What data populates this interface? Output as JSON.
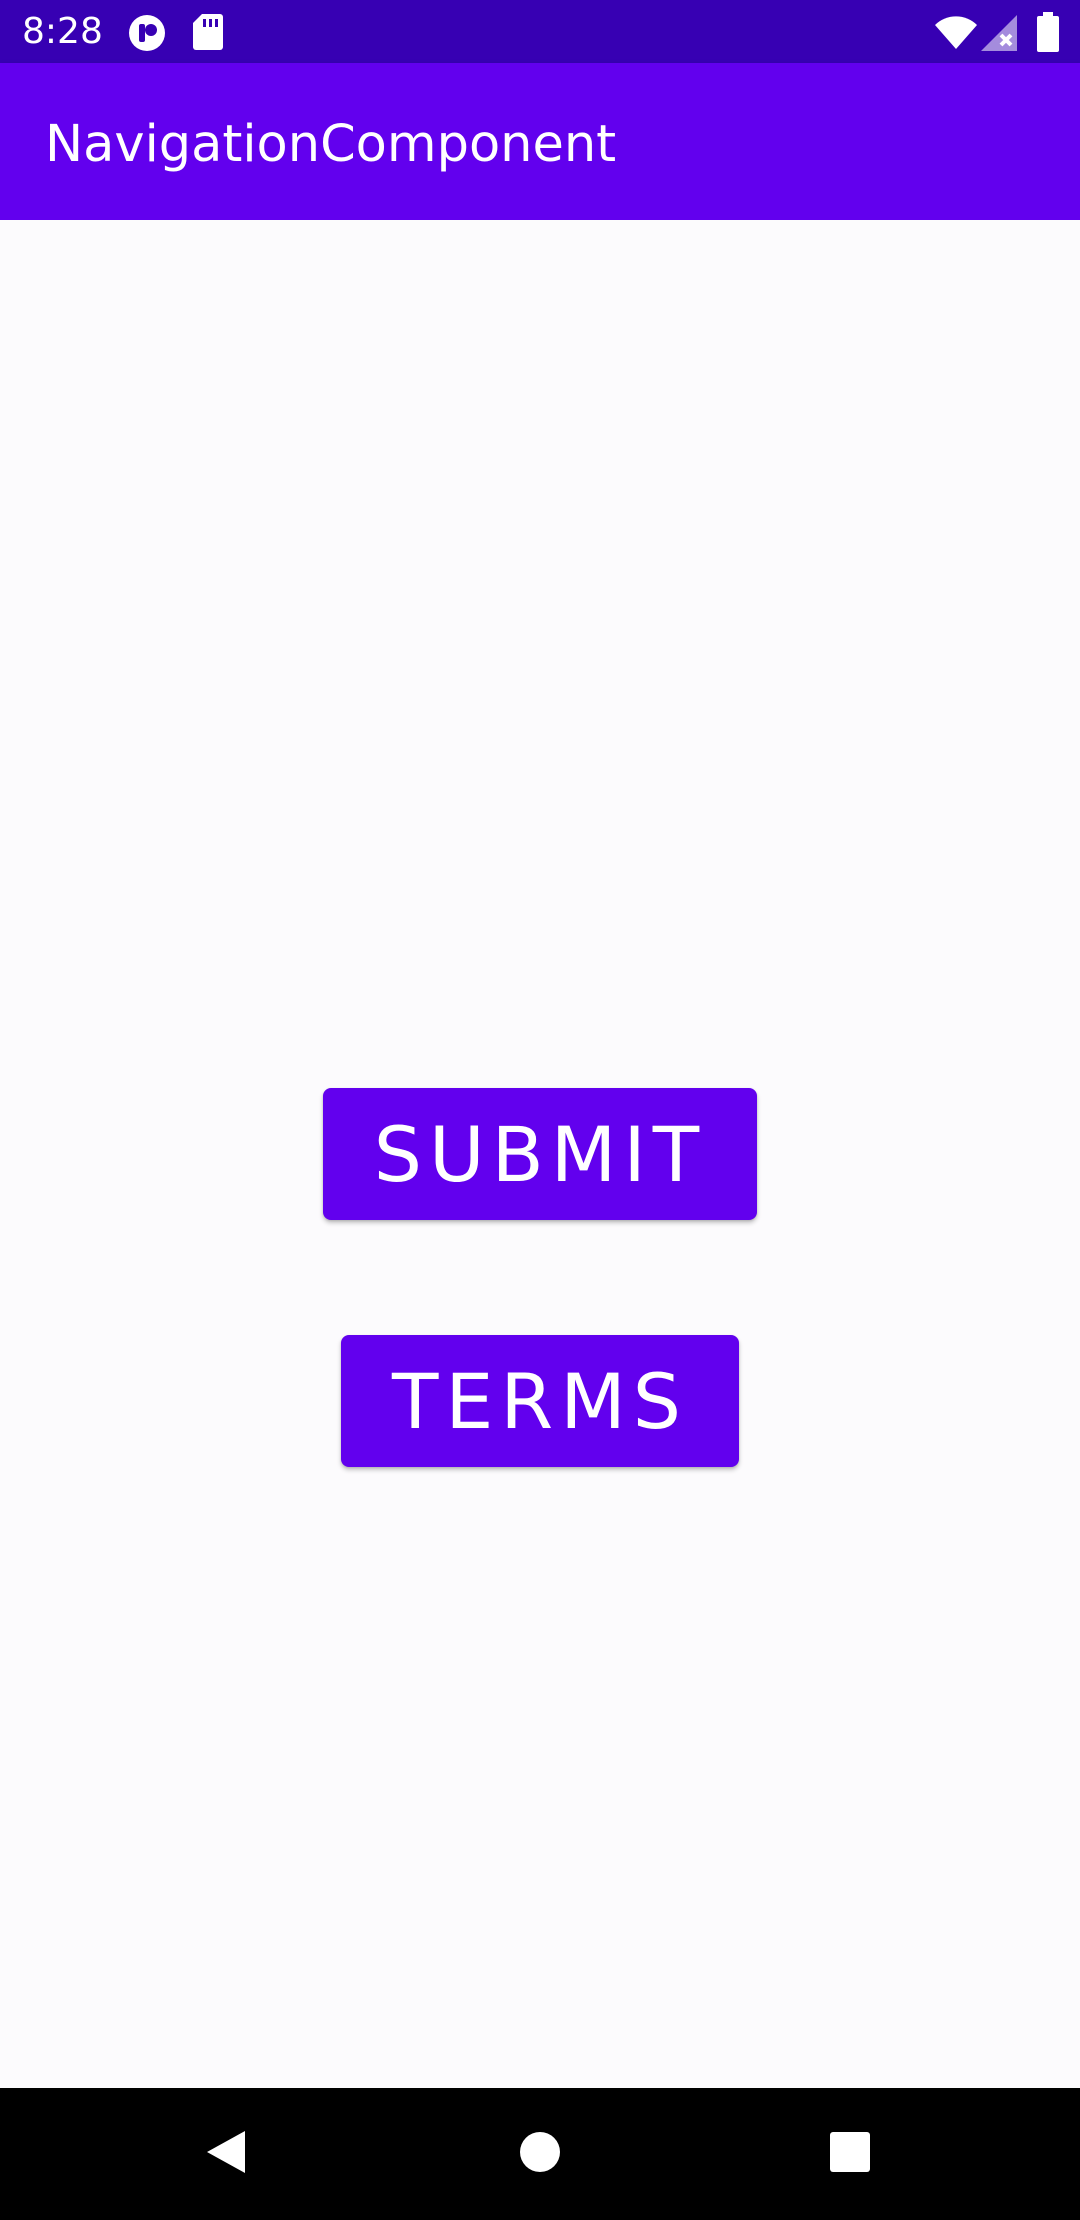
{
  "status_bar": {
    "time": "8:28",
    "icons": [
      "app-notification-icon",
      "sd-card-icon",
      "wifi-icon",
      "signal-icon",
      "battery-icon"
    ],
    "color": "#3700b3"
  },
  "app_bar": {
    "title": "NavigationComponent",
    "color": "#6200ee"
  },
  "main": {
    "buttons": {
      "submit_label": "SUBMIT",
      "terms_label": "TERMS"
    },
    "button_color": "#6200ee"
  },
  "nav_bar": {
    "icons": [
      "back-icon",
      "home-icon",
      "recents-icon"
    ]
  }
}
